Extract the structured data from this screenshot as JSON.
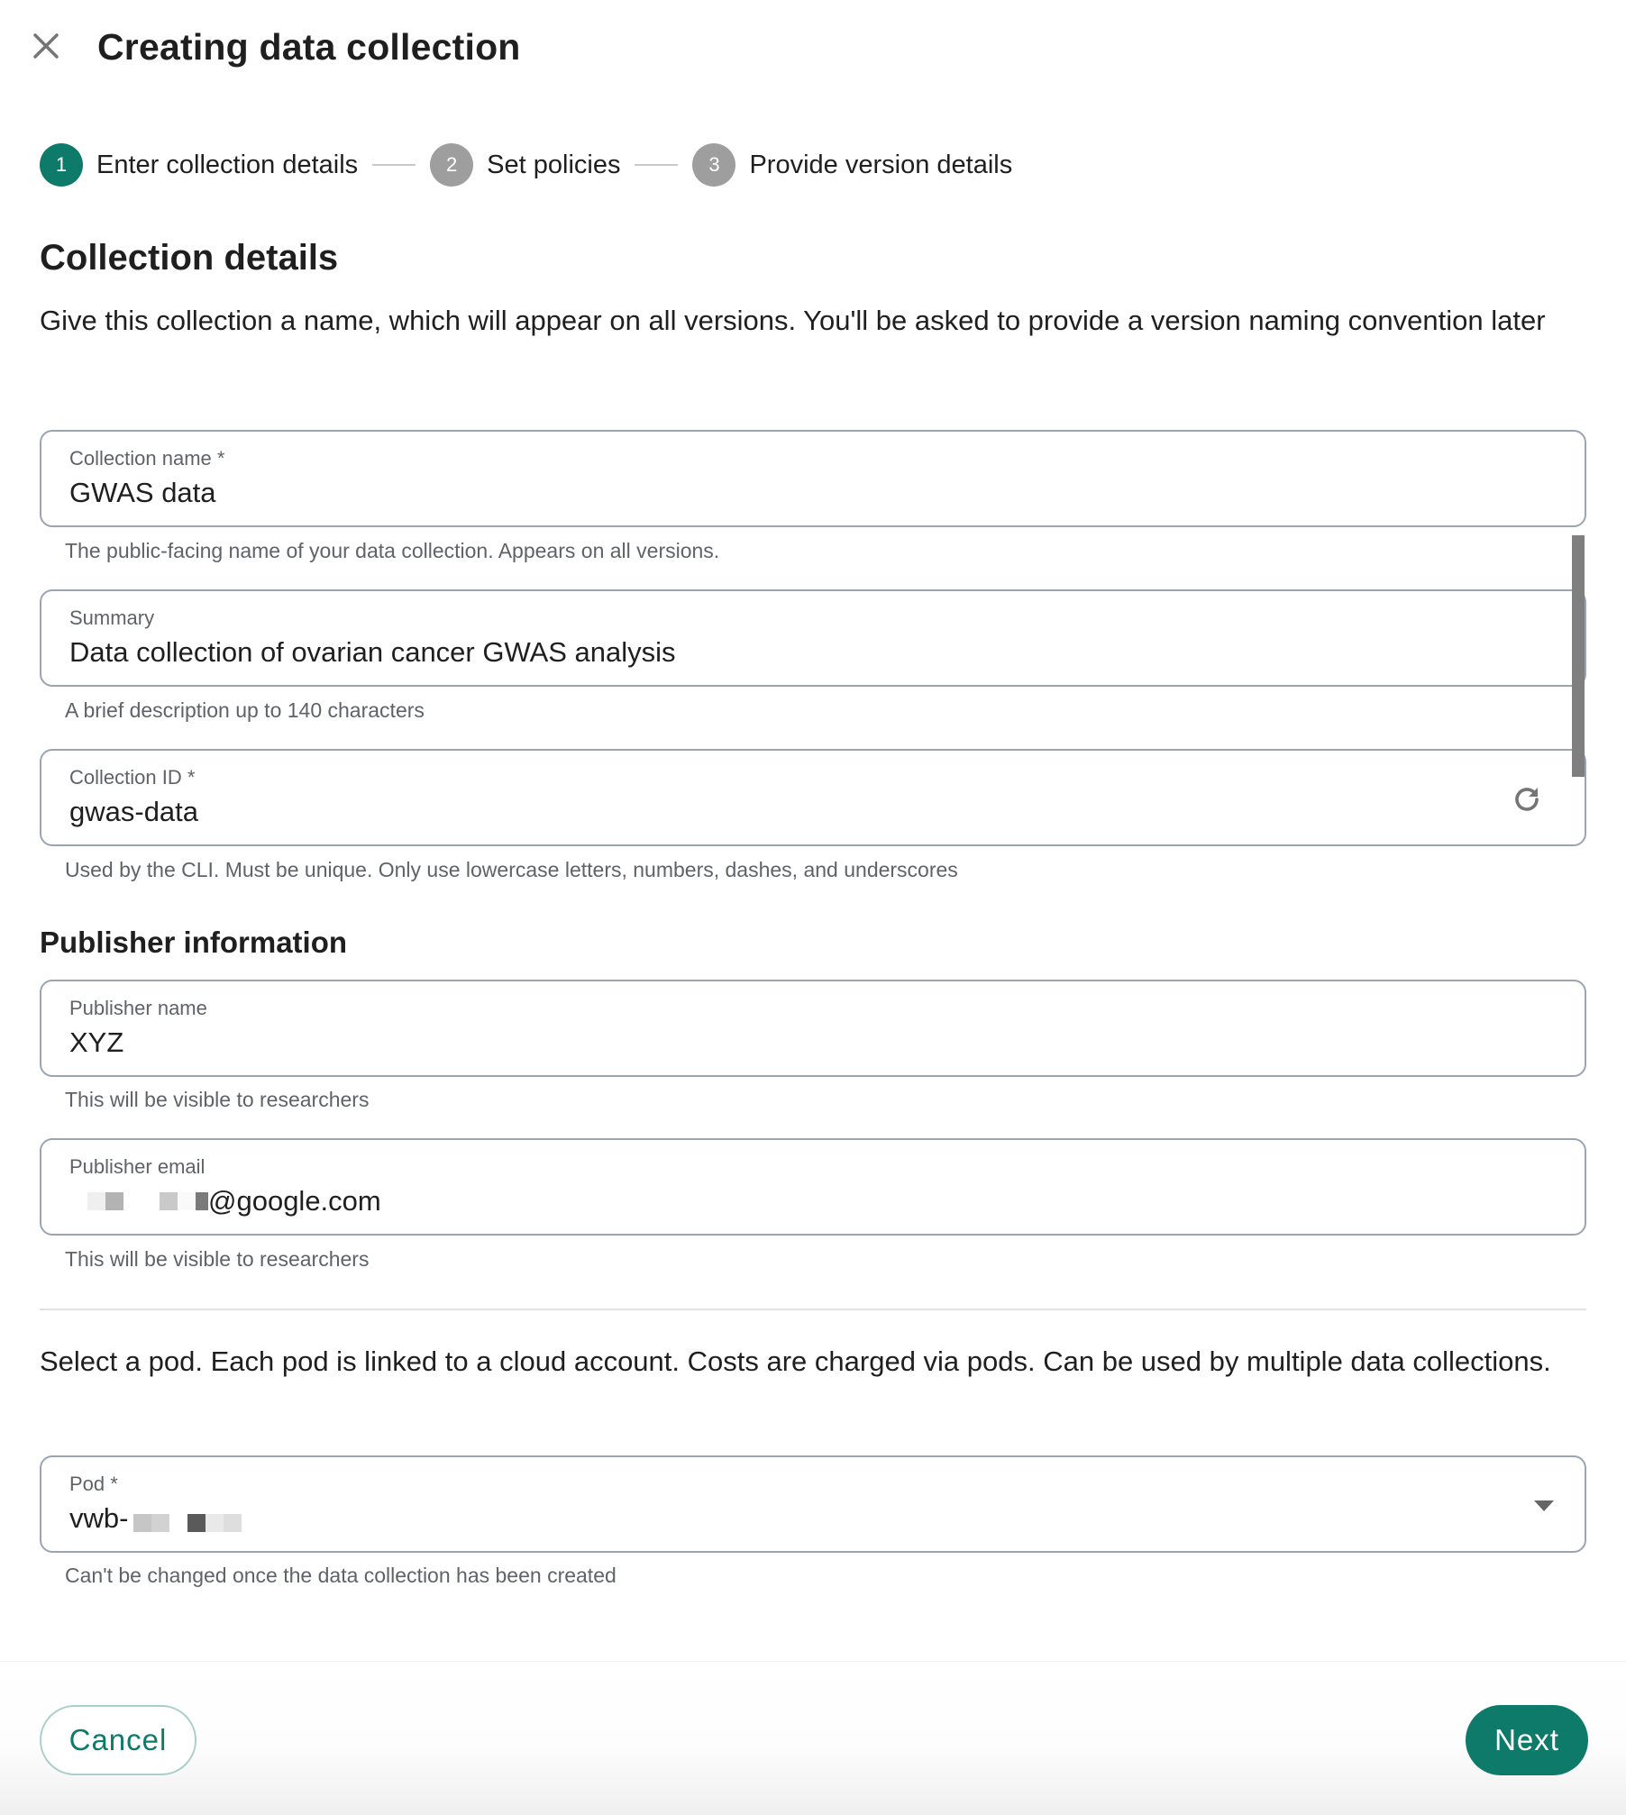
{
  "header": {
    "title": "Creating data collection",
    "close_icon": "close-icon"
  },
  "stepper": {
    "steps": [
      {
        "number": "1",
        "label": "Enter collection details",
        "state": "active"
      },
      {
        "number": "2",
        "label": "Set policies",
        "state": "inactive"
      },
      {
        "number": "3",
        "label": "Provide version details",
        "state": "inactive"
      }
    ]
  },
  "collection_details": {
    "heading": "Collection details",
    "description": "Give this collection a name, which will appear on all versions. You'll be asked to provide a version naming convention later",
    "fields": {
      "name": {
        "label": "Collection name *",
        "value": "GWAS data",
        "helper": "The public-facing name of your data collection. Appears on all versions."
      },
      "summary": {
        "label": "Summary",
        "value": "Data collection of ovarian cancer GWAS analysis",
        "helper": "A brief description up to 140 characters"
      },
      "id": {
        "label": "Collection ID *",
        "value": "gwas-data",
        "helper": "Used by the CLI. Must be unique. Only use lowercase letters, numbers, dashes, and underscores",
        "action_icon": "refresh-icon"
      }
    }
  },
  "publisher": {
    "heading": "Publisher information",
    "name": {
      "label": "Publisher name",
      "value": "XYZ",
      "helper": "This will be visible to researchers"
    },
    "email": {
      "label": "Publisher email",
      "value_suffix": "@google.com",
      "value_redacted": true,
      "helper": "This will be visible to researchers"
    }
  },
  "pod": {
    "description": "Select a pod. Each pod is linked to a cloud account. Costs are charged via pods. Can be used by multiple data collections.",
    "label": "Pod *",
    "value_prefix": "vwb-",
    "value_redacted": true,
    "helper": "Can't be changed once the data collection has been created",
    "dropdown_icon": "dropdown-arrow-icon"
  },
  "footer": {
    "cancel_label": "Cancel",
    "next_label": "Next"
  },
  "colors": {
    "accent": "#0e7a6a",
    "step_inactive": "#9e9e9e",
    "field_border": "#9aa5b1",
    "helper_text": "#5f6368"
  }
}
